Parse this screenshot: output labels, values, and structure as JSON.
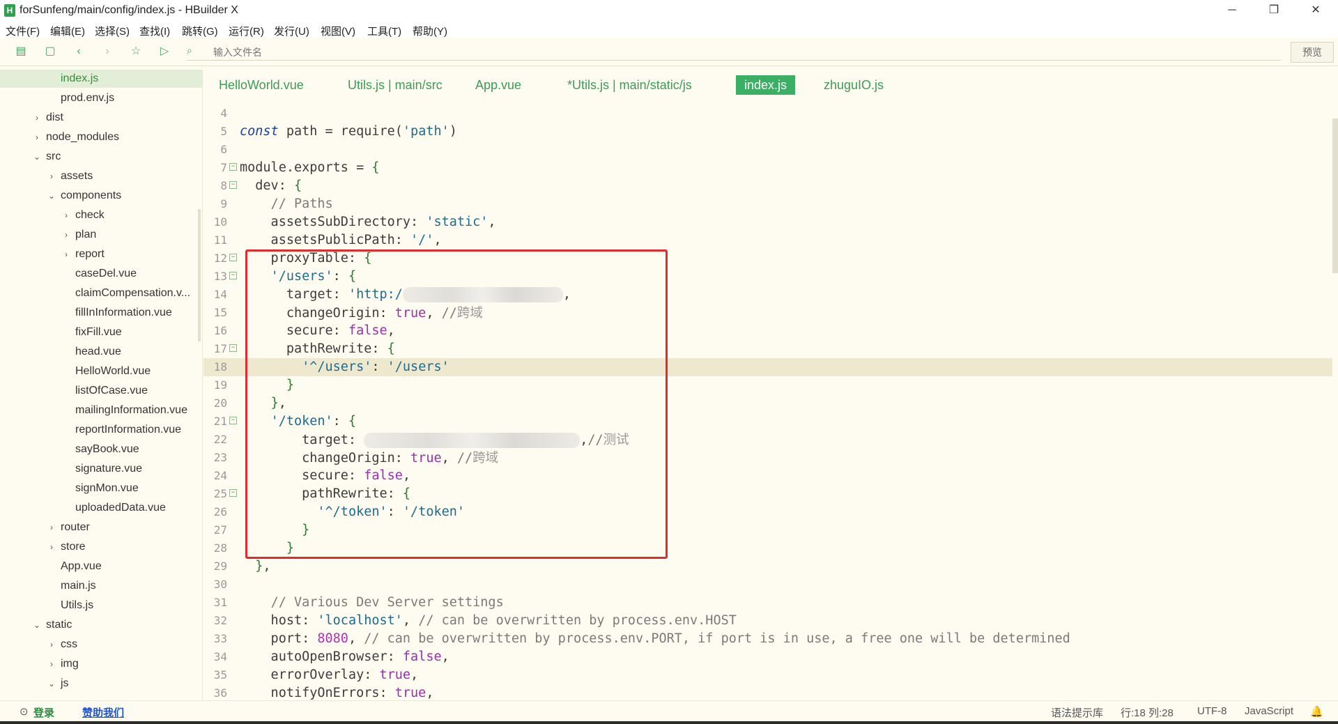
{
  "window": {
    "title": "forSunfeng/main/config/index.js - HBuilder X",
    "minimize": "─",
    "restore": "❐",
    "close": "✕"
  },
  "menu": [
    "文件(F)",
    "编辑(E)",
    "选择(S)",
    "查找(I)",
    "跳转(G)",
    "运行(R)",
    "发行(U)",
    "视图(V)",
    "工具(T)",
    "帮助(Y)"
  ],
  "toolbar": {
    "search_placeholder": "输入文件名",
    "preview_label": "预览"
  },
  "sidebar": [
    {
      "label": "index.js",
      "depth": 4,
      "arrow": "",
      "selected": true
    },
    {
      "label": "prod.env.js",
      "depth": 4,
      "arrow": ""
    },
    {
      "label": "dist",
      "depth": 3,
      "arrow": "›"
    },
    {
      "label": "node_modules",
      "depth": 3,
      "arrow": "›"
    },
    {
      "label": "src",
      "depth": 3,
      "arrow": "⌄"
    },
    {
      "label": "assets",
      "depth": 4,
      "arrow": "›"
    },
    {
      "label": "components",
      "depth": 4,
      "arrow": "⌄"
    },
    {
      "label": "check",
      "depth": 5,
      "arrow": "›"
    },
    {
      "label": "plan",
      "depth": 5,
      "arrow": "›"
    },
    {
      "label": "report",
      "depth": 5,
      "arrow": "›"
    },
    {
      "label": "caseDel.vue",
      "depth": 5,
      "arrow": ""
    },
    {
      "label": "claimCompensation.v...",
      "depth": 5,
      "arrow": ""
    },
    {
      "label": "fillInInformation.vue",
      "depth": 5,
      "arrow": ""
    },
    {
      "label": "fixFill.vue",
      "depth": 5,
      "arrow": ""
    },
    {
      "label": "head.vue",
      "depth": 5,
      "arrow": ""
    },
    {
      "label": "HelloWorld.vue",
      "depth": 5,
      "arrow": ""
    },
    {
      "label": "listOfCase.vue",
      "depth": 5,
      "arrow": ""
    },
    {
      "label": "mailingInformation.vue",
      "depth": 5,
      "arrow": ""
    },
    {
      "label": "reportInformation.vue",
      "depth": 5,
      "arrow": ""
    },
    {
      "label": "sayBook.vue",
      "depth": 5,
      "arrow": ""
    },
    {
      "label": "signature.vue",
      "depth": 5,
      "arrow": ""
    },
    {
      "label": "signMon.vue",
      "depth": 5,
      "arrow": ""
    },
    {
      "label": "uploadedData.vue",
      "depth": 5,
      "arrow": ""
    },
    {
      "label": "router",
      "depth": 4,
      "arrow": "›"
    },
    {
      "label": "store",
      "depth": 4,
      "arrow": "›"
    },
    {
      "label": "App.vue",
      "depth": 4,
      "arrow": ""
    },
    {
      "label": "main.js",
      "depth": 4,
      "arrow": ""
    },
    {
      "label": "Utils.js",
      "depth": 4,
      "arrow": ""
    },
    {
      "label": "static",
      "depth": 3,
      "arrow": "⌄"
    },
    {
      "label": "css",
      "depth": 4,
      "arrow": "›"
    },
    {
      "label": "img",
      "depth": 4,
      "arrow": "›"
    },
    {
      "label": "js",
      "depth": 4,
      "arrow": "⌄"
    }
  ],
  "tabs": [
    {
      "label": "HelloWorld.vue",
      "active": false
    },
    {
      "label": "Utils.js | main/src",
      "active": false
    },
    {
      "label": "App.vue",
      "active": false
    },
    {
      "label": "*Utils.js | main/static/js",
      "active": false
    },
    {
      "label": "index.js",
      "active": true
    },
    {
      "label": "zhuguIO.js",
      "active": false
    }
  ],
  "code_lines": [
    {
      "n": "4",
      "tokens": []
    },
    {
      "n": "5",
      "tokens": [
        [
          "kw",
          "const"
        ],
        [
          "t",
          " path = require("
        ],
        [
          "str",
          "'path'"
        ],
        [
          "t",
          ")"
        ]
      ]
    },
    {
      "n": "6",
      "tokens": []
    },
    {
      "n": "7",
      "fold": true,
      "tokens": [
        [
          "t",
          "module.exports = "
        ],
        [
          "br",
          "{"
        ]
      ]
    },
    {
      "n": "8",
      "fold": true,
      "tokens": [
        [
          "t",
          "  dev: "
        ],
        [
          "br",
          "{"
        ]
      ]
    },
    {
      "n": "9",
      "tokens": [
        [
          "t",
          "    "
        ],
        [
          "com",
          "// Paths"
        ]
      ]
    },
    {
      "n": "10",
      "tokens": [
        [
          "t",
          "    assetsSubDirectory: "
        ],
        [
          "str",
          "'static'"
        ],
        [
          "t",
          ","
        ]
      ]
    },
    {
      "n": "11",
      "tokens": [
        [
          "t",
          "    assetsPublicPath: "
        ],
        [
          "str",
          "'/'"
        ],
        [
          "t",
          ","
        ]
      ]
    },
    {
      "n": "12",
      "fold": true,
      "tokens": [
        [
          "t",
          "    proxyTable: "
        ],
        [
          "br",
          "{"
        ]
      ]
    },
    {
      "n": "13",
      "fold": true,
      "tokens": [
        [
          "t",
          "    "
        ],
        [
          "str",
          "'/users'"
        ],
        [
          "t",
          ": "
        ],
        [
          "br",
          "{"
        ]
      ]
    },
    {
      "n": "14",
      "tokens": [
        [
          "t",
          "      target: "
        ],
        [
          "str",
          "'http:/"
        ],
        [
          "blur",
          "230"
        ],
        [
          "t",
          ","
        ]
      ]
    },
    {
      "n": "15",
      "tokens": [
        [
          "t",
          "      changeOrigin: "
        ],
        [
          "bool",
          "true"
        ],
        [
          "t",
          ", "
        ],
        [
          "com",
          "//"
        ],
        [
          "comcn",
          "跨域"
        ]
      ]
    },
    {
      "n": "16",
      "tokens": [
        [
          "t",
          "      secure: "
        ],
        [
          "bool",
          "false"
        ],
        [
          "t",
          ","
        ]
      ]
    },
    {
      "n": "17",
      "fold": true,
      "tokens": [
        [
          "t",
          "      pathRewrite: "
        ],
        [
          "br",
          "{"
        ]
      ]
    },
    {
      "n": "18",
      "hl": true,
      "tokens": [
        [
          "t",
          "        "
        ],
        [
          "str",
          "'^/users'"
        ],
        [
          "t",
          ": "
        ],
        [
          "str",
          "'/users'"
        ]
      ]
    },
    {
      "n": "19",
      "tokens": [
        [
          "t",
          "      "
        ],
        [
          "br",
          "}"
        ]
      ]
    },
    {
      "n": "20",
      "tokens": [
        [
          "t",
          "    "
        ],
        [
          "br",
          "}"
        ],
        [
          "t",
          ","
        ]
      ]
    },
    {
      "n": "21",
      "fold": true,
      "tokens": [
        [
          "t",
          "    "
        ],
        [
          "str",
          "'/token'"
        ],
        [
          "t",
          ": "
        ],
        [
          "br",
          "{"
        ]
      ]
    },
    {
      "n": "22",
      "tokens": [
        [
          "t",
          "        target: "
        ],
        [
          "blur",
          "310"
        ],
        [
          "t",
          ","
        ],
        [
          "com",
          "//"
        ],
        [
          "comcn",
          "测试"
        ]
      ]
    },
    {
      "n": "23",
      "tokens": [
        [
          "t",
          "        changeOrigin: "
        ],
        [
          "bool",
          "true"
        ],
        [
          "t",
          ", "
        ],
        [
          "com",
          "//"
        ],
        [
          "comcn",
          "跨域"
        ]
      ]
    },
    {
      "n": "24",
      "tokens": [
        [
          "t",
          "        secure: "
        ],
        [
          "bool",
          "false"
        ],
        [
          "t",
          ","
        ]
      ]
    },
    {
      "n": "25",
      "fold": true,
      "tokens": [
        [
          "t",
          "        pathRewrite: "
        ],
        [
          "br",
          "{"
        ]
      ]
    },
    {
      "n": "26",
      "tokens": [
        [
          "t",
          "          "
        ],
        [
          "str",
          "'^/token'"
        ],
        [
          "t",
          ": "
        ],
        [
          "str",
          "'/token'"
        ]
      ]
    },
    {
      "n": "27",
      "tokens": [
        [
          "t",
          "        "
        ],
        [
          "br",
          "}"
        ]
      ]
    },
    {
      "n": "28",
      "tokens": [
        [
          "t",
          "      "
        ],
        [
          "br",
          "}"
        ]
      ]
    },
    {
      "n": "29",
      "tokens": [
        [
          "t",
          "  "
        ],
        [
          "br",
          "}"
        ],
        [
          "t",
          ","
        ]
      ]
    },
    {
      "n": "30",
      "tokens": []
    },
    {
      "n": "31",
      "tokens": [
        [
          "t",
          "    "
        ],
        [
          "com",
          "// Various Dev Server settings"
        ]
      ]
    },
    {
      "n": "32",
      "tokens": [
        [
          "t",
          "    host: "
        ],
        [
          "str",
          "'localhost'"
        ],
        [
          "t",
          ", "
        ],
        [
          "com",
          "// can be overwritten by process.env.HOST"
        ]
      ]
    },
    {
      "n": "33",
      "tokens": [
        [
          "t",
          "    port: "
        ],
        [
          "num",
          "8080"
        ],
        [
          "t",
          ", "
        ],
        [
          "com",
          "// can be overwritten by process.env.PORT, if port is in use, a free one will be determined"
        ]
      ]
    },
    {
      "n": "34",
      "tokens": [
        [
          "t",
          "    autoOpenBrowser: "
        ],
        [
          "bool",
          "false"
        ],
        [
          "t",
          ","
        ]
      ]
    },
    {
      "n": "35",
      "tokens": [
        [
          "t",
          "    errorOverlay: "
        ],
        [
          "bool",
          "true"
        ],
        [
          "t",
          ","
        ]
      ]
    },
    {
      "n": "36",
      "tokens": [
        [
          "t",
          "    notifyOnErrors: "
        ],
        [
          "bool",
          "true"
        ],
        [
          "t",
          ","
        ]
      ]
    }
  ],
  "statusbar": {
    "login": "登录",
    "sponsor": "赞助我们",
    "syntax": "语法提示库",
    "position": "行:18  列:28",
    "encoding": "UTF-8",
    "language": "JavaScript"
  }
}
